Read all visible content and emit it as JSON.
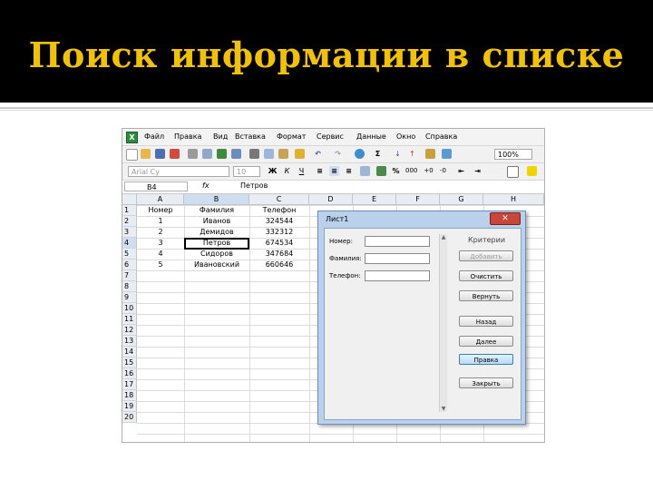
{
  "slide": {
    "title": "Поиск информации в списке"
  },
  "menu": [
    "Файл",
    "Правка",
    "Вид",
    "Вставка",
    "Формат",
    "Сервис",
    "Данные",
    "Окно",
    "Справка"
  ],
  "toolbar": {
    "font": "Arial Cy",
    "size": "10",
    "zoom": "100%",
    "bold": "Ж",
    "italic": "К",
    "underline": "Ч"
  },
  "formula_bar": {
    "name_box": "B4",
    "fx": "fx",
    "value": "Петров"
  },
  "columns": [
    "A",
    "B",
    "C",
    "D",
    "E",
    "F",
    "G",
    "H"
  ],
  "rows": [
    "1",
    "2",
    "3",
    "4",
    "5",
    "6",
    "7",
    "8",
    "9",
    "10",
    "11",
    "12",
    "13",
    "14",
    "15",
    "16",
    "17",
    "18",
    "19",
    "20"
  ],
  "table": {
    "headers": [
      "Номер",
      "Фамилия",
      "Телефон"
    ],
    "rows": [
      [
        "1",
        "Иванов",
        "324544"
      ],
      [
        "2",
        "Демидов",
        "332312"
      ],
      [
        "3",
        "Петров",
        "674534"
      ],
      [
        "4",
        "Сидоров",
        "347684"
      ],
      [
        "5",
        "Ивановский",
        "660646"
      ]
    ]
  },
  "dialog": {
    "title": "Лист1",
    "fields": [
      {
        "label": "Номер:"
      },
      {
        "label": "Фамилия:"
      },
      {
        "label": "Телефон:"
      }
    ],
    "criteria_label": "Критерии",
    "buttons": [
      "Добавить",
      "Очистить",
      "Вернуть",
      "Назад",
      "Далее",
      "Правка",
      "Закрыть"
    ]
  }
}
